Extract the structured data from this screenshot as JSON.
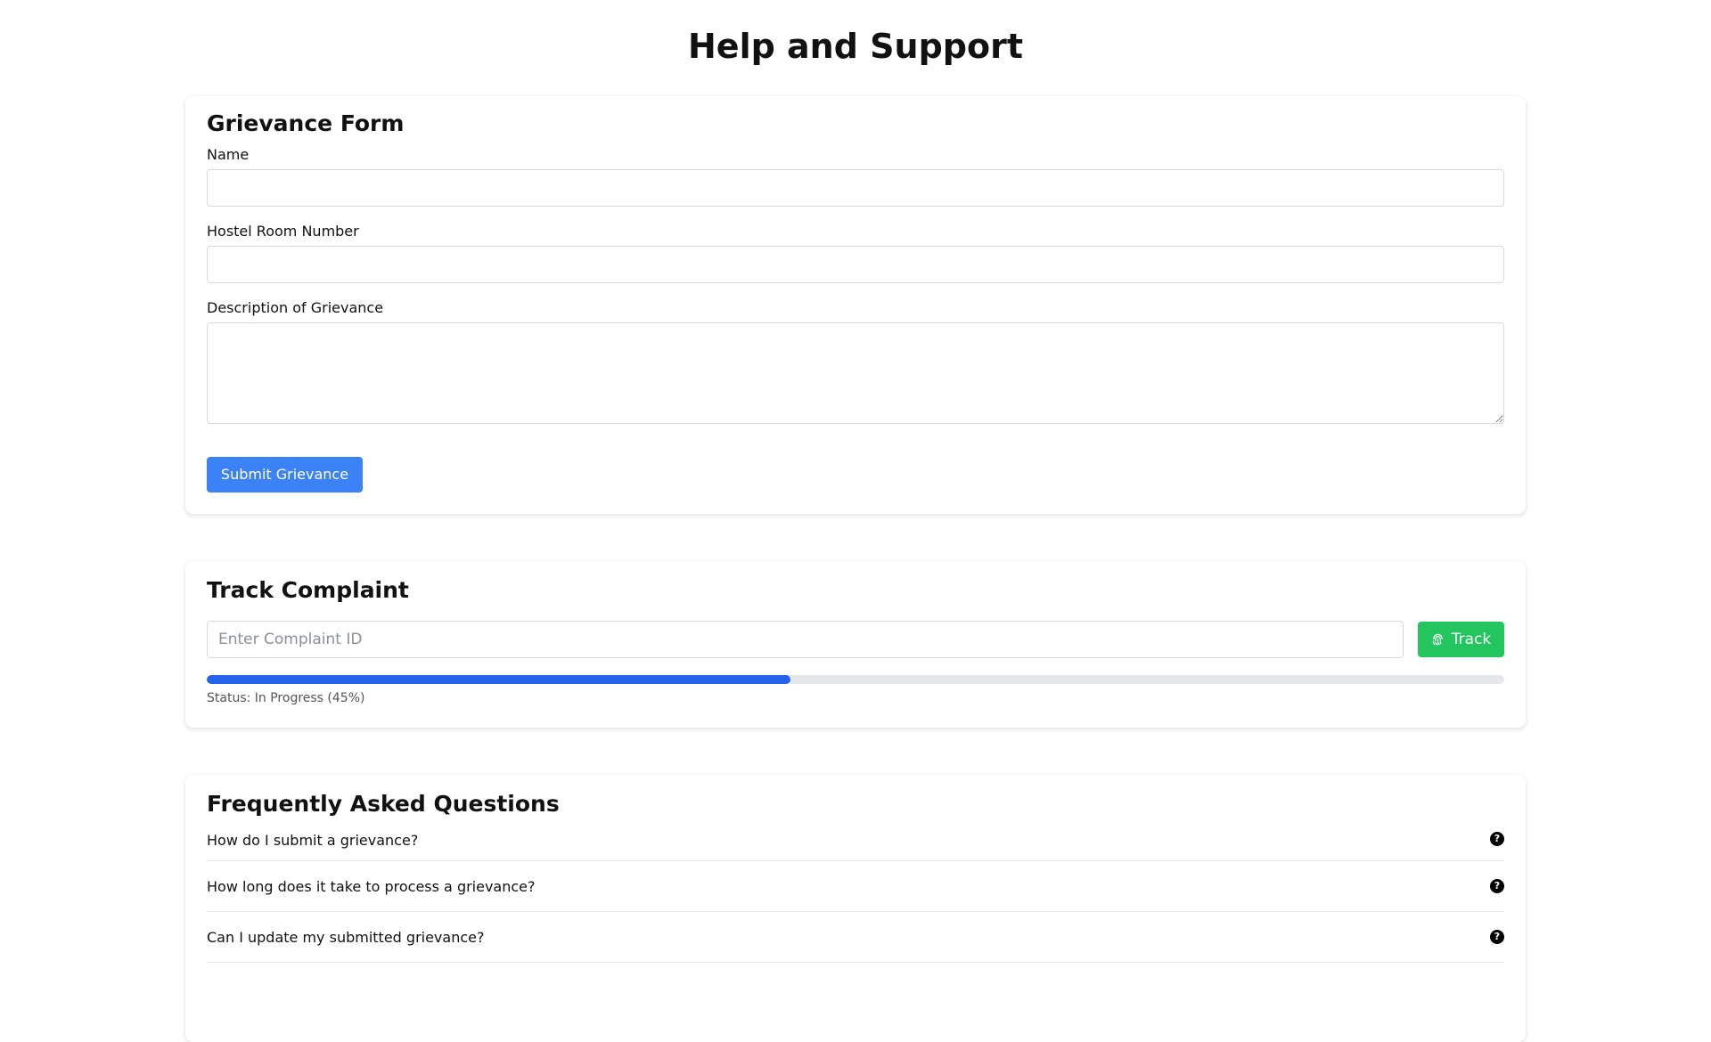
{
  "page": {
    "title": "Help and Support"
  },
  "grievance_form": {
    "title": "Grievance Form",
    "name_label": "Name",
    "name_value": "",
    "room_label": "Hostel Room Number",
    "room_value": "",
    "description_label": "Description of Grievance",
    "description_value": "",
    "submit_label": "Submit Grievance",
    "submit_color": "#3b82f6"
  },
  "track_complaint": {
    "title": "Track Complaint",
    "input_placeholder": "Enter Complaint ID",
    "input_value": "",
    "track_label": "Track",
    "track_icon": "fingerprint-icon",
    "track_color": "#22c55e",
    "progress_percent": 45,
    "progress_color": "#2563eb",
    "status_text": "Status: In Progress (45%)"
  },
  "faq": {
    "title": "Frequently Asked Questions",
    "icon": "question-circle-icon",
    "items": [
      {
        "question": "How do I submit a grievance?"
      },
      {
        "question": "How long does it take to process a grievance?"
      },
      {
        "question": "Can I update my submitted grievance?"
      }
    ]
  }
}
